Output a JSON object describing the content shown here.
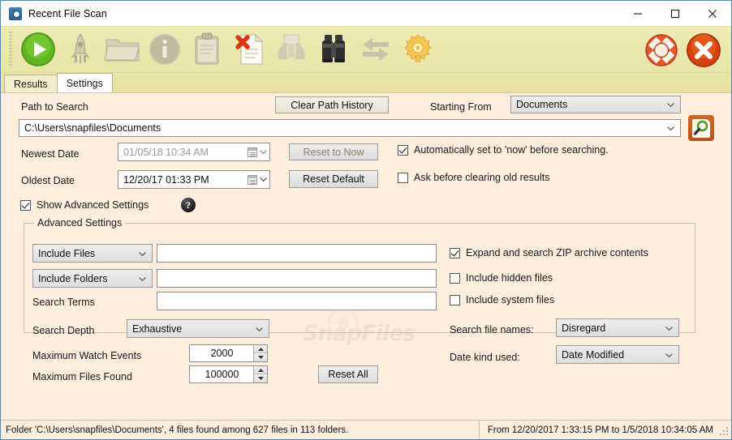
{
  "window": {
    "title": "Recent File Scan",
    "icon": "camera-icon",
    "minimize_label": "—",
    "maximize_label": "☐",
    "close_label": "✕"
  },
  "toolbar": {
    "items": [
      {
        "name": "start-scan-button",
        "icon": "green-play-icon",
        "title": "Start"
      },
      {
        "name": "quick-scan-button",
        "icon": "rocket-icon",
        "title": "Quick Scan"
      },
      {
        "name": "open-folder-button",
        "icon": "folder-icon",
        "title": "Open Folder"
      },
      {
        "name": "info-button",
        "icon": "info-circle-icon",
        "title": "Info"
      },
      {
        "name": "clipboard-button",
        "icon": "clipboard-icon",
        "title": "Copy"
      },
      {
        "name": "clear-results-button",
        "icon": "page-delete-icon",
        "title": "Clear Results"
      },
      {
        "name": "find-disabled-button",
        "icon": "binoculars-grey-icon",
        "title": "Find"
      },
      {
        "name": "find-button",
        "icon": "binoculars-icon",
        "title": "Find"
      },
      {
        "name": "swap-button",
        "icon": "swap-arrows-icon",
        "title": "Swap"
      },
      {
        "name": "options-button",
        "icon": "gear-icon",
        "title": "Options"
      }
    ],
    "right_items": [
      {
        "name": "help-button",
        "icon": "lifering-icon",
        "title": "Help"
      },
      {
        "name": "exit-button",
        "icon": "red-x-icon",
        "title": "Exit"
      }
    ]
  },
  "tabs": [
    {
      "label": "Results",
      "active": false
    },
    {
      "label": "Settings",
      "active": true
    }
  ],
  "settings": {
    "path_label": "Path to Search",
    "clear_path_history_label": "Clear Path History",
    "starting_from_label": "Starting From",
    "starting_from_value": "Documents",
    "path_value": "C:\\Users\\snapfiles\\Documents",
    "search_button_icon": "magnifier-page-icon",
    "newest_date_label": "Newest Date",
    "newest_date_value": "01/05/18 10:34 AM",
    "reset_to_now_label": "Reset to Now",
    "auto_now_label": "Automatically set to 'now' before searching.",
    "auto_now_checked": true,
    "oldest_date_label": "Oldest Date",
    "oldest_date_value": "12/20/17 01:33 PM",
    "reset_default_label": "Reset Default",
    "ask_before_clearing_label": "Ask before clearing old results",
    "ask_before_clearing_checked": false,
    "show_advanced_label": "Show Advanced Settings",
    "show_advanced_checked": true,
    "help_glyph": "?"
  },
  "advanced": {
    "group_title": "Advanced Settings",
    "include_files_mode": "Include Files",
    "include_files_value": "",
    "include_folders_mode": "Include Folders",
    "include_folders_value": "",
    "search_terms_label": "Search Terms",
    "search_terms_value": "",
    "search_depth_label": "Search Depth",
    "search_depth_value": "Exhaustive",
    "max_watch_events_label": "Maximum Watch Events",
    "max_watch_events_value": "2000",
    "max_files_found_label": "Maximum Files Found",
    "max_files_found_value": "100000",
    "reset_all_label": "Reset All",
    "expand_zip_label": "Expand and search ZIP archive contents",
    "expand_zip_checked": true,
    "hidden_files_label": "Include hidden files",
    "hidden_files_checked": false,
    "system_files_label": "Include system files",
    "system_files_checked": false,
    "search_file_names_label": "Search file names:",
    "search_file_names_value": "Disregard",
    "date_kind_label": "Date kind used:",
    "date_kind_value": "Date Modified"
  },
  "watermark": {
    "text": "SnapFiles"
  },
  "statusbar": {
    "left": "Folder 'C:\\Users\\snapfiles\\Documents', 4 files found among 627 files in 113 folders.",
    "right": "From 12/20/2017 1:33:15 PM to 1/5/2018 10:34:05 AM"
  },
  "colors": {
    "toolbar": "#e9e4a8",
    "body": "#fdeede",
    "accent_orange": "#c25f1e",
    "green": "#4aa216"
  }
}
